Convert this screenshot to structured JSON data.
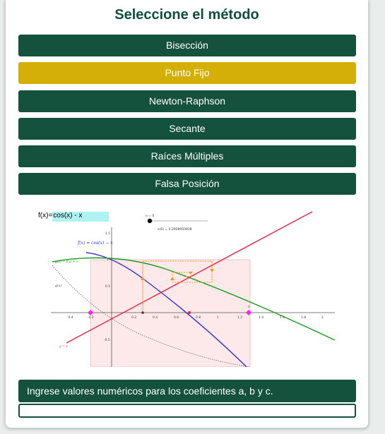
{
  "title": "Seleccione el método",
  "methods": [
    {
      "label": "Bisección",
      "active": false
    },
    {
      "label": "Punto Fijo",
      "active": true
    },
    {
      "label": "Newton-Raphson",
      "active": false
    },
    {
      "label": "Secante",
      "active": false
    },
    {
      "label": "Raíces Múltiples",
      "active": false
    },
    {
      "label": "Falsa Posición",
      "active": false
    }
  ],
  "applet": {
    "input_label": "f(x)=",
    "input_value": "cos(x) - x",
    "slider_label": "n = 0",
    "x0_readout": "x(0) = 0.2928950838",
    "curve_f_label": "f(x) = cos(x) − x",
    "curve_g_label": "g(x) = f(x) + x",
    "curve_gx_label": "g(x)",
    "line_label": "y = x",
    "b_label": "b",
    "x_ticks": [
      "-0.4",
      "-0.2",
      "0.2",
      "0.4",
      "0.6",
      "0.8",
      "1",
      "1.2",
      "1.4",
      "1.6",
      "1.8",
      "2"
    ],
    "y_ticks": [
      "1.5",
      "1",
      "0.5",
      "-0.5"
    ]
  },
  "message": "Ingrese valores numéricos para los coeficientes a, b y c.",
  "answer_value": "",
  "colors": {
    "primary": "#14523e",
    "active": "#d4af08",
    "title": "#0f4f3c"
  }
}
